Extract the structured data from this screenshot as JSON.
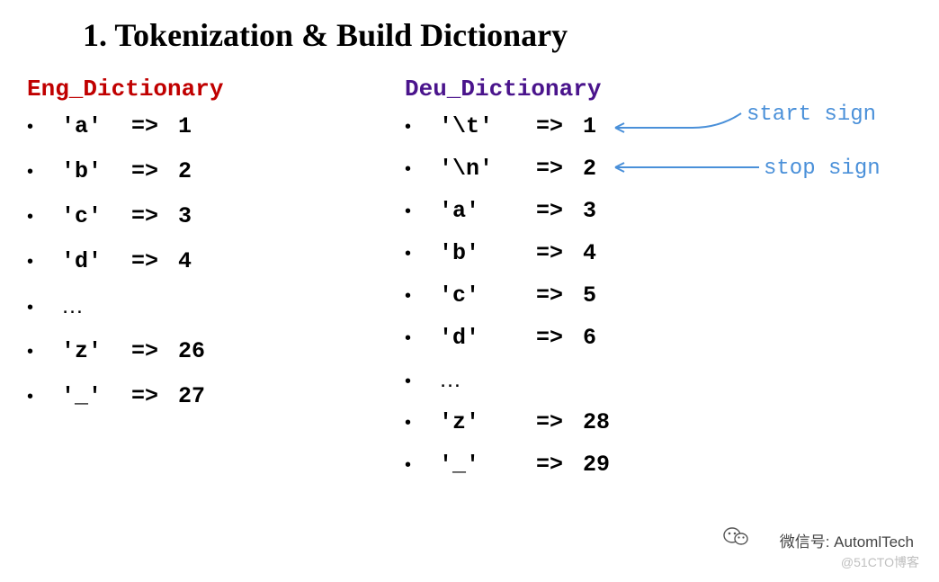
{
  "title": "1. Tokenization & Build Dictionary",
  "eng": {
    "header": "Eng_Dictionary",
    "entries": [
      {
        "key": "'a'",
        "val": "1"
      },
      {
        "key": "'b'",
        "val": "2"
      },
      {
        "key": "'c'",
        "val": "3"
      },
      {
        "key": "'d'",
        "val": "4"
      },
      {
        "ellipsis": "…"
      },
      {
        "key": "'z'",
        "val": "26"
      },
      {
        "key": "'_'",
        "val": "27"
      }
    ]
  },
  "deu": {
    "header": "Deu_Dictionary",
    "entries": [
      {
        "key": "'\\t'",
        "val": "1"
      },
      {
        "key": "'\\n'",
        "val": "2"
      },
      {
        "key": "'a'",
        "val": "3"
      },
      {
        "key": "'b'",
        "val": "4"
      },
      {
        "key": "'c'",
        "val": "5"
      },
      {
        "key": "'d'",
        "val": "6"
      },
      {
        "ellipsis": "…"
      },
      {
        "key": "'z'",
        "val": "28"
      },
      {
        "key": "'_'",
        "val": "29"
      }
    ]
  },
  "annotations": {
    "start": "start sign",
    "stop": "stop sign"
  },
  "arrow_symbol": "=>",
  "bullet": "•",
  "watermark": {
    "wechat_label": "微信号: AutomlTech",
    "blog": "@51CTO博客"
  }
}
